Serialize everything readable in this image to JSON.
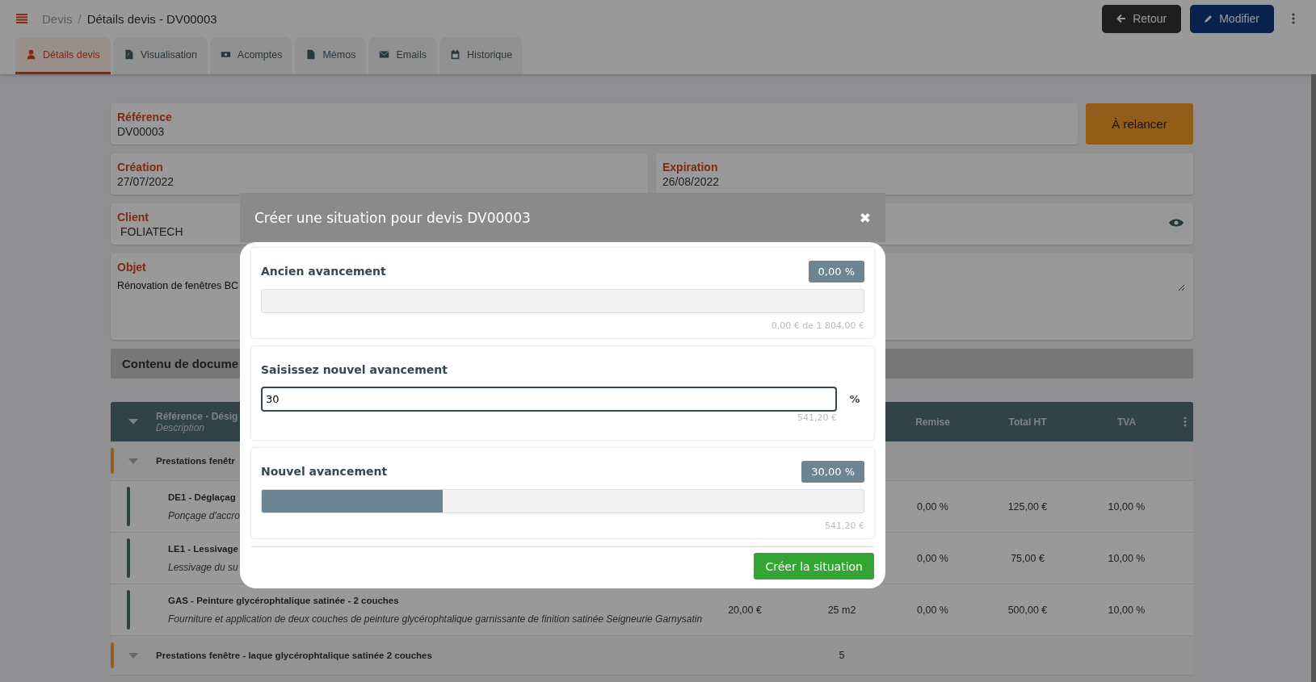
{
  "header": {
    "breadcrumb": [
      "Devis",
      "Détails devis - DV00003"
    ],
    "separator": "/",
    "buttons": [
      {
        "label": "Retour",
        "kind": "back"
      },
      {
        "label": "Modifier",
        "kind": "edit"
      }
    ]
  },
  "tabs": [
    {
      "label": "Détails devis",
      "selected": true
    },
    {
      "label": "Visualisation",
      "selected": false
    },
    {
      "label": "Acomptes",
      "selected": false
    },
    {
      "label": "Mémos",
      "selected": false
    },
    {
      "label": "Emails",
      "selected": false
    },
    {
      "label": "Historique",
      "selected": false
    }
  ],
  "fields": {
    "reference": {
      "label": "Référence",
      "value": "DV00003"
    },
    "status_button": "À relancer",
    "creation": {
      "label": "Création",
      "value": "27/07/2022"
    },
    "expiration": {
      "label": "Expiration",
      "value": "26/08/2022"
    },
    "client": {
      "label": "Client",
      "value": "FOLIATECH"
    },
    "object": {
      "label": "Objet",
      "value": "Rénovation de fenêtres BC"
    }
  },
  "content_title": "Contenu de docume",
  "table": {
    "columns": [
      {
        "label": "Référence - Désig",
        "sublabel": "Description"
      },
      {
        "label": "Remise"
      },
      {
        "label": "Total HT"
      },
      {
        "label": "TVA"
      }
    ],
    "rows": [
      {
        "kind": "group",
        "title": "Prestations fenêtr"
      },
      {
        "kind": "item",
        "title": "DE1 - Déglaçag",
        "description": "Ponçage d'accro",
        "discount": "0,00 %",
        "total": "125,00 €",
        "vat": "10,00 %"
      },
      {
        "kind": "item",
        "title": "LE1 - Lessivage",
        "description": "Lessivage du su",
        "discount": "0,00 %",
        "total": "75,00 €",
        "vat": "10,00 %"
      },
      {
        "kind": "item",
        "title": "GAS - Peinture glycérophtalique satinée - 2 couches",
        "description": "Fourniture et application de deux couches de peinture glycérophtalique garnissante de finition satinée Seigneurie Garnysatin",
        "price": "20,00 €",
        "quantity": "25 m2",
        "discount": "0,00 %",
        "total": "500,00 €",
        "vat": "10,00 %"
      },
      {
        "kind": "group",
        "title": "Prestations fenêtre - laque glycérophtalique satinée 2 couches",
        "quantity": "5"
      }
    ]
  },
  "modal": {
    "title": "Créer une situation pour devis DV00003",
    "close": "✖",
    "sections": [
      {
        "kind": "progress",
        "label": "Ancien avancement",
        "badge": "0,00 %",
        "level": 0,
        "amount": "0,00 € de 1 804,00 €"
      },
      {
        "kind": "input",
        "label": "Saisissez nouvel avancement",
        "value": "30",
        "unit": "%",
        "amount": "541,20 €"
      },
      {
        "kind": "progress",
        "label": "Nouvel avancement",
        "badge": "30,00 %",
        "level": 0.3,
        "amount": "541,20 €"
      }
    ],
    "submit": "Créer la situation"
  }
}
